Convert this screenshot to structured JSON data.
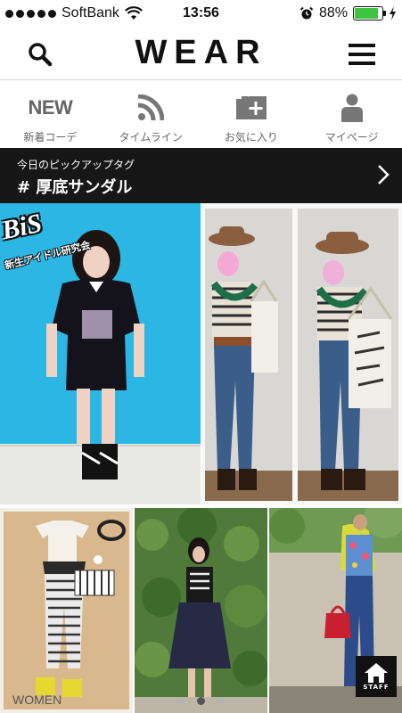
{
  "status_bar": {
    "carrier": "SoftBank",
    "time": "13:56",
    "battery": "88%",
    "battery_level": 0.88,
    "icons": [
      "signal-dots-icon",
      "wifi-icon",
      "alarm-icon",
      "battery-icon",
      "charging-icon"
    ]
  },
  "header": {
    "logo": "WEAR",
    "left_icon": "search-icon",
    "right_icon": "menu-icon"
  },
  "nav_tabs": [
    {
      "icon_text": "NEW",
      "label": "新着コーデ",
      "icon": "new-text-icon"
    },
    {
      "label": "タイムライン",
      "icon": "rss-icon"
    },
    {
      "label": "お気に入り",
      "icon": "favorite-folder-plus-icon"
    },
    {
      "label": "マイページ",
      "icon": "person-icon"
    }
  ],
  "pickup": {
    "caption": "今日のピックアップタグ",
    "tag": "# 厚底サンダル",
    "icon": "chevron-right-icon"
  },
  "photos": {
    "overlay_title": "BiS",
    "overlay_subtitle": "新生アイドル研究会"
  },
  "footer": {
    "section": "WOMEN",
    "staff_label": "STAFF",
    "staff_icon": "home-icon",
    "page_count": 3,
    "active_page": 2
  },
  "colors": {
    "battery": "#3ec43e",
    "pickup_bar": "#171717",
    "blue_wall": "#2bb6e3"
  }
}
